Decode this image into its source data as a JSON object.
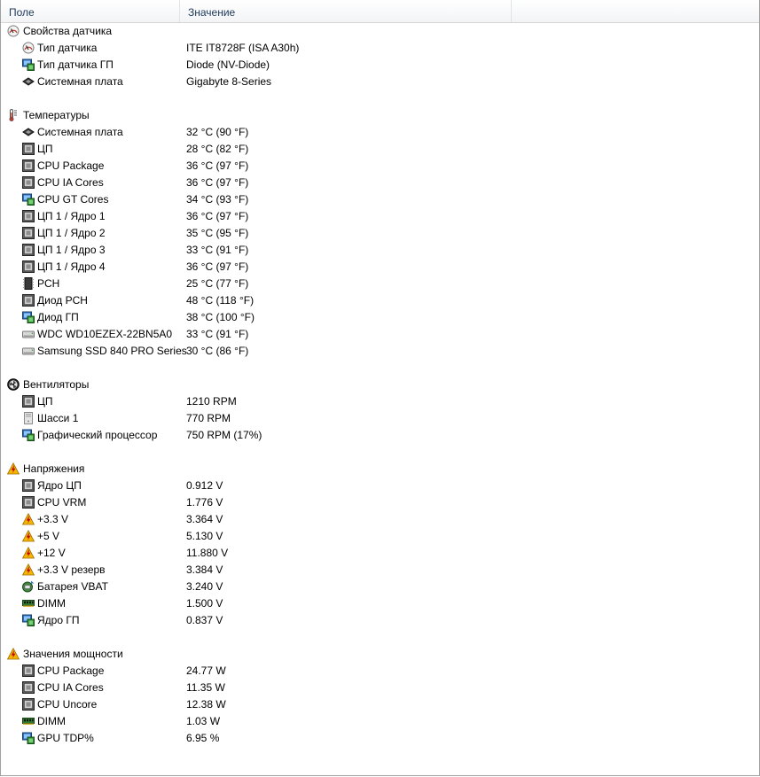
{
  "columns": {
    "field": "Поле",
    "value": "Значение"
  },
  "groups": [
    {
      "label": "Свойства датчика",
      "icon": "sensor-gauge-icon",
      "items": [
        {
          "label": "Тип датчика",
          "value": "ITE IT8728F  (ISA A30h)",
          "icon": "sensor-gauge-icon"
        },
        {
          "label": "Тип датчика ГП",
          "value": "Diode  (NV-Diode)",
          "icon": "gpu-monitor-icon"
        },
        {
          "label": "Системная плата",
          "value": "Gigabyte 8-Series",
          "icon": "motherboard-icon"
        }
      ]
    },
    {
      "label": "Температуры",
      "icon": "thermometer-icon",
      "items": [
        {
          "label": "Системная плата",
          "value": "32 °C  (90 °F)",
          "icon": "motherboard-icon"
        },
        {
          "label": "ЦП",
          "value": "28 °C  (82 °F)",
          "icon": "cpu-chip-icon"
        },
        {
          "label": "CPU Package",
          "value": "36 °C  (97 °F)",
          "icon": "cpu-chip-icon"
        },
        {
          "label": "CPU IA Cores",
          "value": "36 °C  (97 °F)",
          "icon": "cpu-chip-icon"
        },
        {
          "label": "CPU GT Cores",
          "value": "34 °C  (93 °F)",
          "icon": "gpu-monitor-icon"
        },
        {
          "label": "ЦП 1 / Ядро 1",
          "value": "36 °C  (97 °F)",
          "icon": "cpu-chip-icon"
        },
        {
          "label": "ЦП 1 / Ядро 2",
          "value": "35 °C  (95 °F)",
          "icon": "cpu-chip-icon"
        },
        {
          "label": "ЦП 1 / Ядро 3",
          "value": "33 °C  (91 °F)",
          "icon": "cpu-chip-icon"
        },
        {
          "label": "ЦП 1 / Ядро 4",
          "value": "36 °C  (97 °F)",
          "icon": "cpu-chip-icon"
        },
        {
          "label": "PCH",
          "value": "25 °C  (77 °F)",
          "icon": "pch-chip-icon"
        },
        {
          "label": "Диод PCH",
          "value": "48 °C  (118 °F)",
          "icon": "cpu-chip-icon"
        },
        {
          "label": "Диод ГП",
          "value": "38 °C  (100 °F)",
          "icon": "gpu-monitor-icon"
        },
        {
          "label": "WDC WD10EZEX-22BN5A0",
          "value": "33 °C  (91 °F)",
          "icon": "hard-drive-icon"
        },
        {
          "label": "Samsung SSD 840 PRO Series",
          "value": "30 °C  (86 °F)",
          "icon": "hard-drive-icon"
        }
      ]
    },
    {
      "label": "Вентиляторы",
      "icon": "fan-icon",
      "items": [
        {
          "label": "ЦП",
          "value": "1210 RPM",
          "icon": "cpu-chip-icon"
        },
        {
          "label": "Шасси 1",
          "value": "770 RPM",
          "icon": "chassis-icon"
        },
        {
          "label": "Графический процессор",
          "value": "750 RPM  (17%)",
          "icon": "gpu-monitor-icon"
        }
      ]
    },
    {
      "label": "Напряжения",
      "icon": "voltage-warning-icon",
      "items": [
        {
          "label": "Ядро ЦП",
          "value": "0.912 V",
          "icon": "cpu-chip-icon"
        },
        {
          "label": "CPU VRM",
          "value": "1.776 V",
          "icon": "cpu-chip-icon"
        },
        {
          "label": "+3.3 V",
          "value": "3.364 V",
          "icon": "voltage-warning-icon"
        },
        {
          "label": "+5 V",
          "value": "5.130 V",
          "icon": "voltage-warning-icon"
        },
        {
          "label": "+12 V",
          "value": "11.880 V",
          "icon": "voltage-warning-icon"
        },
        {
          "label": "+3.3 V резерв",
          "value": "3.384 V",
          "icon": "voltage-warning-icon"
        },
        {
          "label": "Батарея VBAT",
          "value": "3.240 V",
          "icon": "battery-icon"
        },
        {
          "label": "DIMM",
          "value": "1.500 V",
          "icon": "dimm-icon"
        },
        {
          "label": "Ядро ГП",
          "value": "0.837 V",
          "icon": "gpu-monitor-icon"
        }
      ]
    },
    {
      "label": "Значения мощности",
      "icon": "voltage-warning-icon",
      "items": [
        {
          "label": "CPU Package",
          "value": "24.77 W",
          "icon": "cpu-chip-icon"
        },
        {
          "label": "CPU IA Cores",
          "value": "11.35 W",
          "icon": "cpu-chip-icon"
        },
        {
          "label": "CPU Uncore",
          "value": "12.38 W",
          "icon": "cpu-chip-icon"
        },
        {
          "label": "DIMM",
          "value": "1.03 W",
          "icon": "dimm-icon"
        },
        {
          "label": "GPU TDP%",
          "value": "6.95 %",
          "icon": "gpu-monitor-icon"
        }
      ]
    }
  ]
}
